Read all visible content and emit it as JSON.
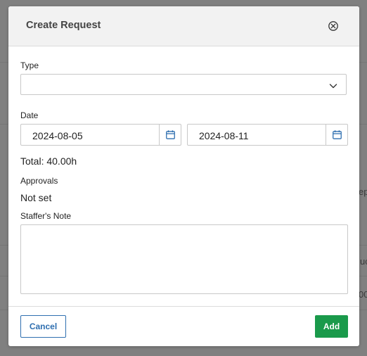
{
  "background": {
    "fragments": [
      "ep",
      "uc",
      "00"
    ]
  },
  "modal": {
    "title": "Create Request",
    "close_icon": "close-circle-icon"
  },
  "form": {
    "type_label": "Type",
    "type_value": "",
    "date_label": "Date",
    "start_date": "2024-08-05",
    "end_date": "2024-08-11",
    "calendar_icon": "calendar-icon",
    "total_text": "Total: 40.00h",
    "approvals_label": "Approvals",
    "approvals_value": "Not set",
    "note_label": "Staffer's Note",
    "note_value": ""
  },
  "footer": {
    "cancel_label": "Cancel",
    "add_label": "Add"
  },
  "colors": {
    "primary": "#2f6fb0",
    "success": "#1a9a4b",
    "calendar_icon": "#2f6fb0"
  }
}
